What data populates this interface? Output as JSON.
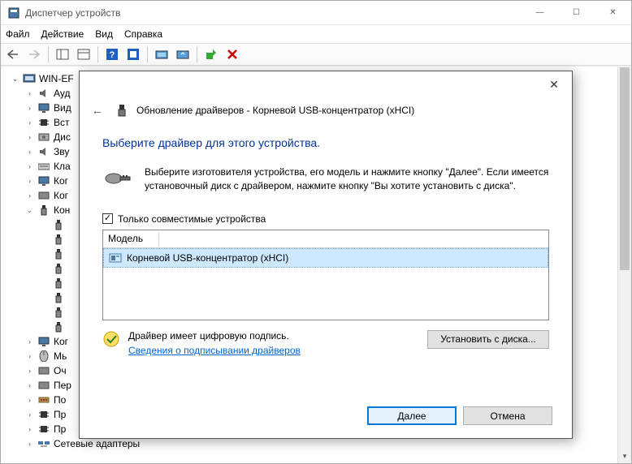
{
  "window": {
    "title": "Диспетчер устройств",
    "minimize": "—",
    "maximize": "☐",
    "close": "✕"
  },
  "menu": {
    "file": "Файл",
    "action": "Действие",
    "view": "Вид",
    "help": "Справка"
  },
  "tree": {
    "root": "WIN-EF",
    "items": [
      "Ауд",
      "Вид",
      "Вст",
      "Дис",
      "Зву",
      "Кла",
      "Ког",
      "Ког",
      "Кон",
      "",
      "",
      "",
      "",
      "",
      "",
      "",
      "",
      "Ког",
      "Мь",
      "Оч",
      "Пер",
      "По",
      "Пр",
      "Пр"
    ],
    "last": "Сетевые адаптеры"
  },
  "dialog": {
    "breadcrumb": "Обновление драйверов - Корневой USB-концентратор (xHCI)",
    "heading": "Выберите драйвер для этого устройства.",
    "instructions": "Выберите изготовителя устройства, его модель и нажмите кнопку \"Далее\". Если имеется установочный диск с  драйвером, нажмите кнопку \"Вы хотите установить с диска\".",
    "checkbox_label": "Только совместимые устройства",
    "checkbox_checked": "✓",
    "list_header": "Модель",
    "selected_item": "Корневой USB-концентратор (xHCI)",
    "signed_line": "Драйвер имеет цифровую подпись.",
    "signed_link": "Сведения о подписывании драйверов",
    "install_disk": "Установить с диска...",
    "next": "Далее",
    "cancel": "Отмена"
  }
}
